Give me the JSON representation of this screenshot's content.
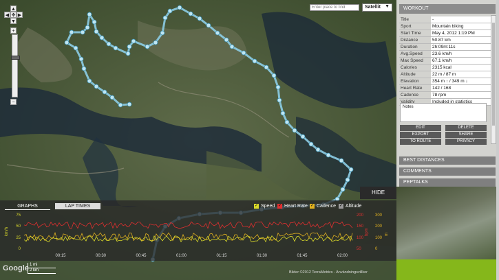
{
  "map": {
    "search_placeholder": "Enter place to find",
    "map_type": "Satellit",
    "hide_label": "HIDE",
    "scale_mi": "1 mi",
    "scale_km": "2 km",
    "google_logo": "Google",
    "attribution": "Bilder ©2012 TerraMetrics - Användningsvillkor"
  },
  "graph": {
    "tabs": [
      "GRAPHS",
      "LAP TIMES"
    ],
    "legend": [
      {
        "label": "Speed",
        "color": "#d9d92b",
        "checked": true
      },
      {
        "label": "Heart Rate",
        "color": "#e03030",
        "checked": true
      },
      {
        "label": "Cadence",
        "color": "#e0b020",
        "checked": true
      },
      {
        "label": "Altitude",
        "color": "#9a9a9a",
        "checked": true
      }
    ],
    "left_axis_label": "km/h",
    "left_ticks": [
      "75",
      "50",
      "25",
      "0"
    ],
    "right_axis_label": "bpm",
    "right_ticks_hr": [
      "200",
      "150",
      "100",
      "50"
    ],
    "right_axis2_label": "m",
    "right_ticks_alt": [
      "300",
      "200",
      "100",
      "0"
    ],
    "time_ticks": [
      "00:15",
      "00:30",
      "00:45",
      "01:00",
      "01:15",
      "01:30",
      "01:45",
      "02:00"
    ]
  },
  "panel": {
    "workout_header": "WORKOUT",
    "rows": [
      {
        "k": "Title",
        "v": "-"
      },
      {
        "k": "Sport",
        "v": "Mountain biking"
      },
      {
        "k": "Start Time",
        "v": "May 4, 2012 1:19 PM"
      },
      {
        "k": "Distance",
        "v": "50.87 km"
      },
      {
        "k": "Duration",
        "v": "2h:09m:11s"
      },
      {
        "k": "Avg.Speed",
        "v": "23.6 km/h"
      },
      {
        "k": "Max Speed",
        "v": "67.1 km/h"
      },
      {
        "k": "Calories",
        "v": "2315 kcal"
      },
      {
        "k": "Altitude",
        "v": "22 m / 87 m"
      },
      {
        "k": "Elevation",
        "v": "354 m ↑ / 349 m ↓"
      },
      {
        "k": "Heart Rate",
        "v": "142 / 168"
      },
      {
        "k": "Cadence",
        "v": "78 rpm"
      },
      {
        "k": "Validity",
        "v": "Included in statistics"
      }
    ],
    "notes_label": "Notes",
    "buttons": [
      "EDIT",
      "DELETE",
      "EXPORT",
      "SHARE",
      "TO ROUTE",
      "PRIVACY"
    ],
    "sections": [
      "BEST DISTANCES",
      "COMMENTS",
      "PEPTALKS"
    ]
  }
}
